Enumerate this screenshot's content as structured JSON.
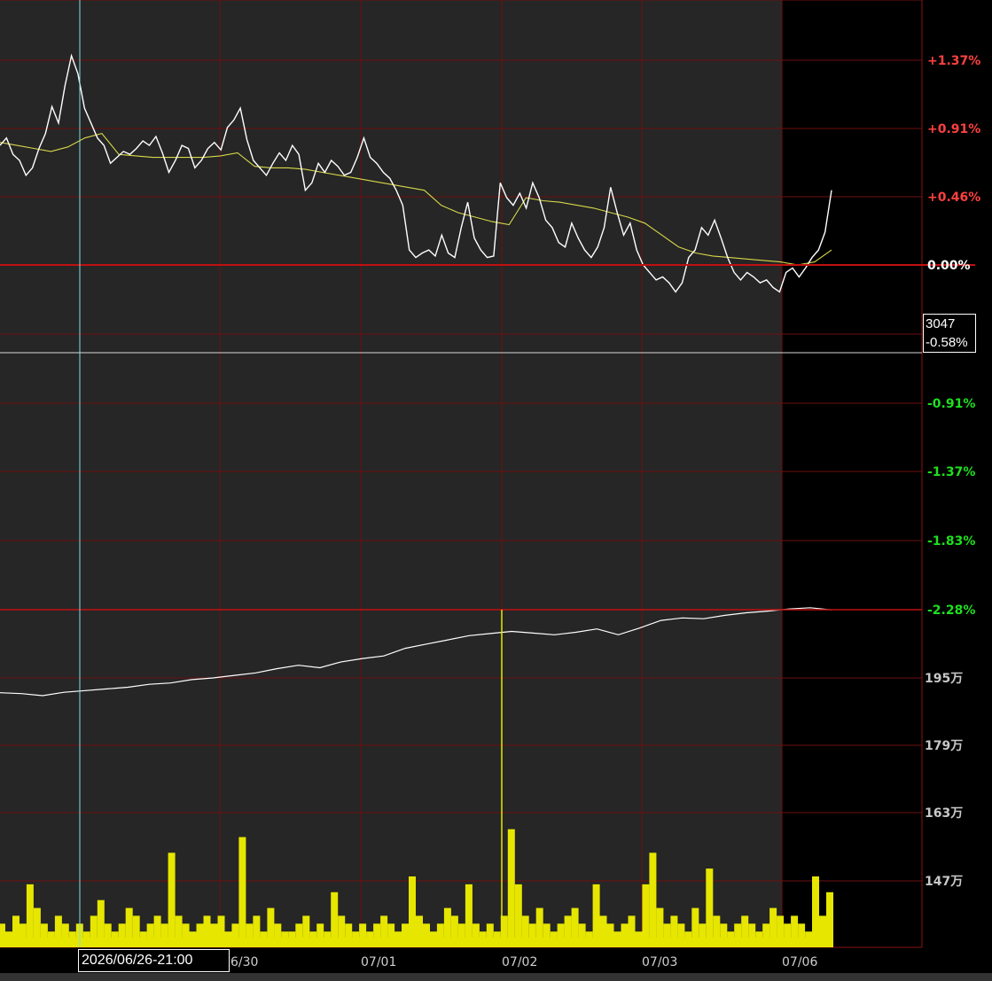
{
  "chart_data": {
    "type": "line",
    "price_axis_labels": [
      "+1.37%",
      "+0.91%",
      "+0.46%",
      "0.00%",
      "-0.91%",
      "-1.37%",
      "-1.83%",
      "-2.28%"
    ],
    "volume_axis_labels": [
      "195万",
      "179万",
      "163万",
      "147万"
    ],
    "x_tick_labels": [
      "6/30",
      "07/01",
      "07/02",
      "07/03",
      "07/06"
    ],
    "series": [
      {
        "type": "line",
        "color": "#ffffff",
        "values": [
          0.8,
          0.85,
          0.74,
          0.7,
          0.6,
          0.65,
          0.78,
          0.88,
          1.06,
          0.95,
          1.2,
          1.4,
          1.28,
          1.05,
          0.95,
          0.85,
          0.8,
          0.68,
          0.72,
          0.76,
          0.74,
          0.78,
          0.83,
          0.8,
          0.86,
          0.75,
          0.62,
          0.7,
          0.8,
          0.78,
          0.65,
          0.7,
          0.78,
          0.82,
          0.77,
          0.92,
          0.97,
          1.05,
          0.84,
          0.7,
          0.65,
          0.6,
          0.68,
          0.75,
          0.7,
          0.8,
          0.74,
          0.5,
          0.55,
          0.68,
          0.62,
          0.7,
          0.66,
          0.6,
          0.62,
          0.72,
          0.85,
          0.72,
          0.68,
          0.62,
          0.58,
          0.5,
          0.4,
          0.1,
          0.05,
          0.08,
          0.1,
          0.06,
          0.2,
          0.08,
          0.05,
          0.25,
          0.42,
          0.18,
          0.1,
          0.05,
          0.06,
          0.55,
          0.45,
          0.4,
          0.48,
          0.38,
          0.55,
          0.45,
          0.3,
          0.25,
          0.15,
          0.12,
          0.28,
          0.18,
          0.1,
          0.05,
          0.12,
          0.25,
          0.52,
          0.35,
          0.2,
          0.28,
          0.1,
          0.0,
          -0.05,
          -0.1,
          -0.08,
          -0.12,
          -0.18,
          -0.12,
          0.05,
          0.1,
          0.25,
          0.2,
          0.3,
          0.18,
          0.05,
          -0.05,
          -0.1,
          -0.05,
          -0.08,
          -0.12,
          -0.1,
          -0.15,
          -0.18,
          -0.05,
          -0.02,
          -0.08,
          -0.02,
          0.05,
          0.1,
          0.22,
          0.5
        ],
        "name": ""
      },
      {
        "type": "line",
        "color": "#d8d84a",
        "values": [
          0.82,
          0.8,
          0.78,
          0.76,
          0.79,
          0.85,
          0.88,
          0.74,
          0.73,
          0.72,
          0.72,
          0.72,
          0.72,
          0.73,
          0.75,
          0.66,
          0.65,
          0.65,
          0.64,
          0.62,
          0.6,
          0.58,
          0.56,
          0.54,
          0.52,
          0.5,
          0.4,
          0.35,
          0.32,
          0.29,
          0.27,
          0.45,
          0.43,
          0.42,
          0.4,
          0.38,
          0.35,
          0.32,
          0.28,
          0.2,
          0.12,
          0.08,
          0.06,
          0.05,
          0.04,
          0.03,
          0.02,
          0.0,
          0.02,
          0.1
        ],
        "name": ""
      },
      {
        "type": "line",
        "color": "#ffffff",
        "values": [
          191.5,
          191.3,
          190.8,
          191.6,
          192.0,
          192.4,
          192.8,
          193.5,
          193.8,
          194.6,
          195.0,
          195.6,
          196.2,
          197.2,
          198.0,
          197.4,
          198.8,
          199.6,
          200.2,
          202.0,
          203.0,
          204.0,
          205.0,
          205.5,
          206.0,
          205.6,
          205.2,
          205.8,
          206.6,
          205.2,
          206.8,
          208.6,
          209.2,
          209.0,
          209.8,
          210.4,
          210.8,
          211.3,
          211.6,
          211.1
        ],
        "name": ""
      },
      {
        "type": "bar",
        "color": "#e6e600",
        "values": [
          3,
          2,
          4,
          3,
          8,
          5,
          3,
          2,
          4,
          3,
          2,
          3,
          2,
          4,
          6,
          3,
          2,
          3,
          5,
          4,
          2,
          3,
          4,
          3,
          12,
          4,
          3,
          2,
          3,
          4,
          3,
          4,
          2,
          3,
          14,
          3,
          4,
          2,
          5,
          3,
          2,
          2,
          3,
          4,
          2,
          3,
          2,
          7,
          4,
          3,
          2,
          3,
          2,
          3,
          4,
          3,
          2,
          3,
          9,
          4,
          3,
          2,
          3,
          5,
          4,
          3,
          8,
          3,
          2,
          3,
          2,
          4,
          15,
          8,
          4,
          3,
          5,
          3,
          2,
          3,
          4,
          5,
          3,
          2,
          8,
          4,
          3,
          2,
          3,
          4,
          2,
          8,
          12,
          5,
          3,
          4,
          3,
          2,
          5,
          3,
          10,
          4,
          3,
          2,
          3,
          4,
          3,
          2,
          3,
          5,
          4,
          3,
          4,
          3,
          2,
          9,
          4,
          7
        ],
        "name": ""
      }
    ]
  },
  "crosshair": {
    "value": "3047",
    "percent": "-0.58%"
  },
  "cursor_date": "2026/06/26-21:00"
}
